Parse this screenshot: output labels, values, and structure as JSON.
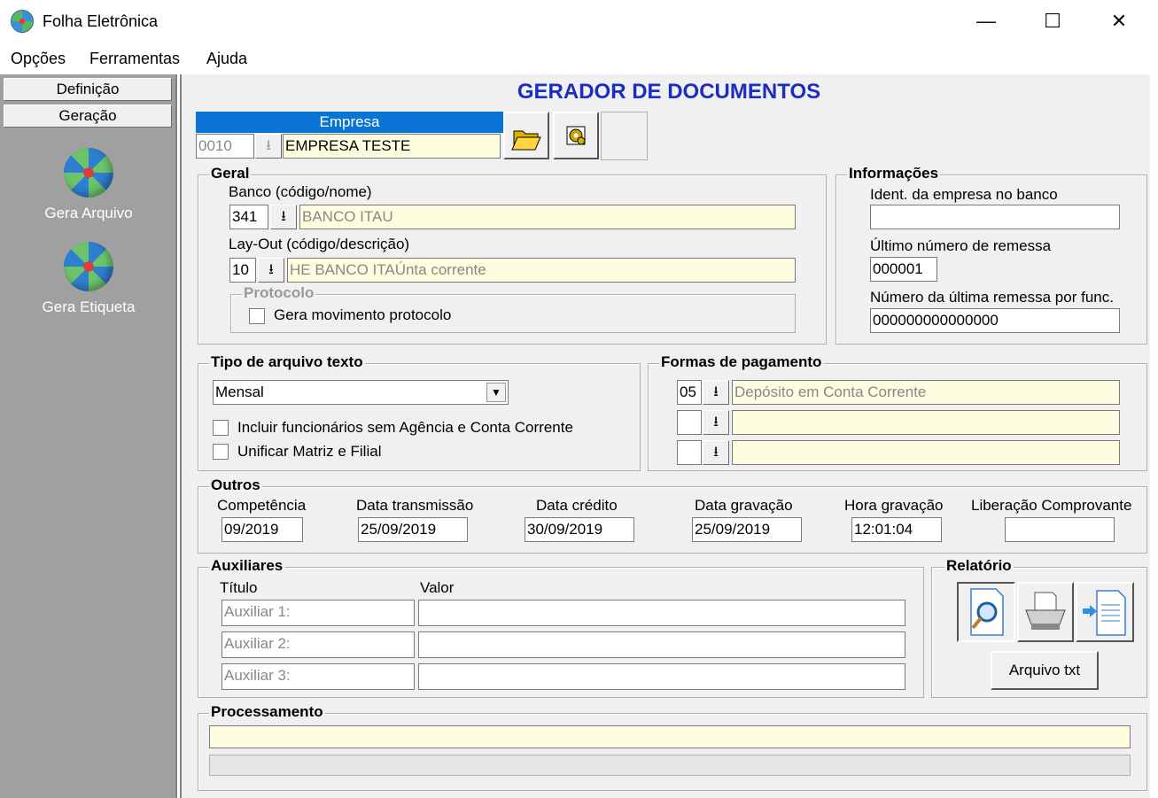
{
  "window": {
    "title": "Folha Eletrônica",
    "minimize": "—",
    "maximize": "☐",
    "close": "✕"
  },
  "menu": {
    "items": [
      "Opções",
      "Ferramentas",
      "Ajuda"
    ]
  },
  "sidebar": {
    "tabs": [
      "Definição",
      "Geração"
    ],
    "items": [
      "Gera Arquivo",
      "Gera Etiqueta"
    ]
  },
  "main": {
    "title": "GERADOR DE DOCUMENTOS"
  },
  "empresa": {
    "header": "Empresa",
    "code": "0010",
    "name": "EMPRESA TESTE"
  },
  "geral": {
    "title": "Geral",
    "banco_label": "Banco (código/nome)",
    "banco_code": "341",
    "banco_name": "BANCO ITAU",
    "layout_label": "Lay-Out (código/descrição)",
    "layout_code": "10",
    "layout_name": "HE BANCO ITAÚnta corrente",
    "protocolo_title": "Protocolo",
    "protocolo_check": "Gera movimento protocolo"
  },
  "informacoes": {
    "title": "Informações",
    "ident_label": "Ident. da empresa no banco",
    "ident_value": "",
    "ultimo_label": "Último número de remessa",
    "ultimo_value": "000001",
    "numero_label": "Número da última remessa por func.",
    "numero_value": "000000000000000"
  },
  "tipo": {
    "title": "Tipo de arquivo texto",
    "selected": "Mensal",
    "check1": "Incluir funcionários sem Agência e Conta Corrente",
    "check2": "Unificar Matriz e Filial"
  },
  "formas": {
    "title": "Formas de pagamento",
    "rows": [
      {
        "code": "05",
        "desc": "Depósito em Conta Corrente"
      },
      {
        "code": "",
        "desc": ""
      },
      {
        "code": "",
        "desc": ""
      }
    ]
  },
  "outros": {
    "title": "Outros",
    "competencia_label": "Competência",
    "competencia": "09/2019",
    "transmissao_label": "Data transmissão",
    "transmissao": "25/09/2019",
    "credito_label": "Data crédito",
    "credito": "30/09/2019",
    "gravacao_label": "Data gravação",
    "gravacao": "25/09/2019",
    "hora_label": "Hora gravação",
    "hora": "12:01:04",
    "liberacao_label": "Liberação Comprovante",
    "liberacao": ""
  },
  "auxiliares": {
    "title": "Auxiliares",
    "col_titulo": "Título",
    "col_valor": "Valor",
    "rows": [
      {
        "titulo": "Auxiliar 1:",
        "valor": ""
      },
      {
        "titulo": "Auxiliar 2:",
        "valor": ""
      },
      {
        "titulo": "Auxiliar 3:",
        "valor": ""
      }
    ]
  },
  "relatorio": {
    "title": "Relatório",
    "arquivo_btn": "Arquivo txt"
  },
  "processamento": {
    "title": "Processamento",
    "status": "",
    "progress": 0
  }
}
